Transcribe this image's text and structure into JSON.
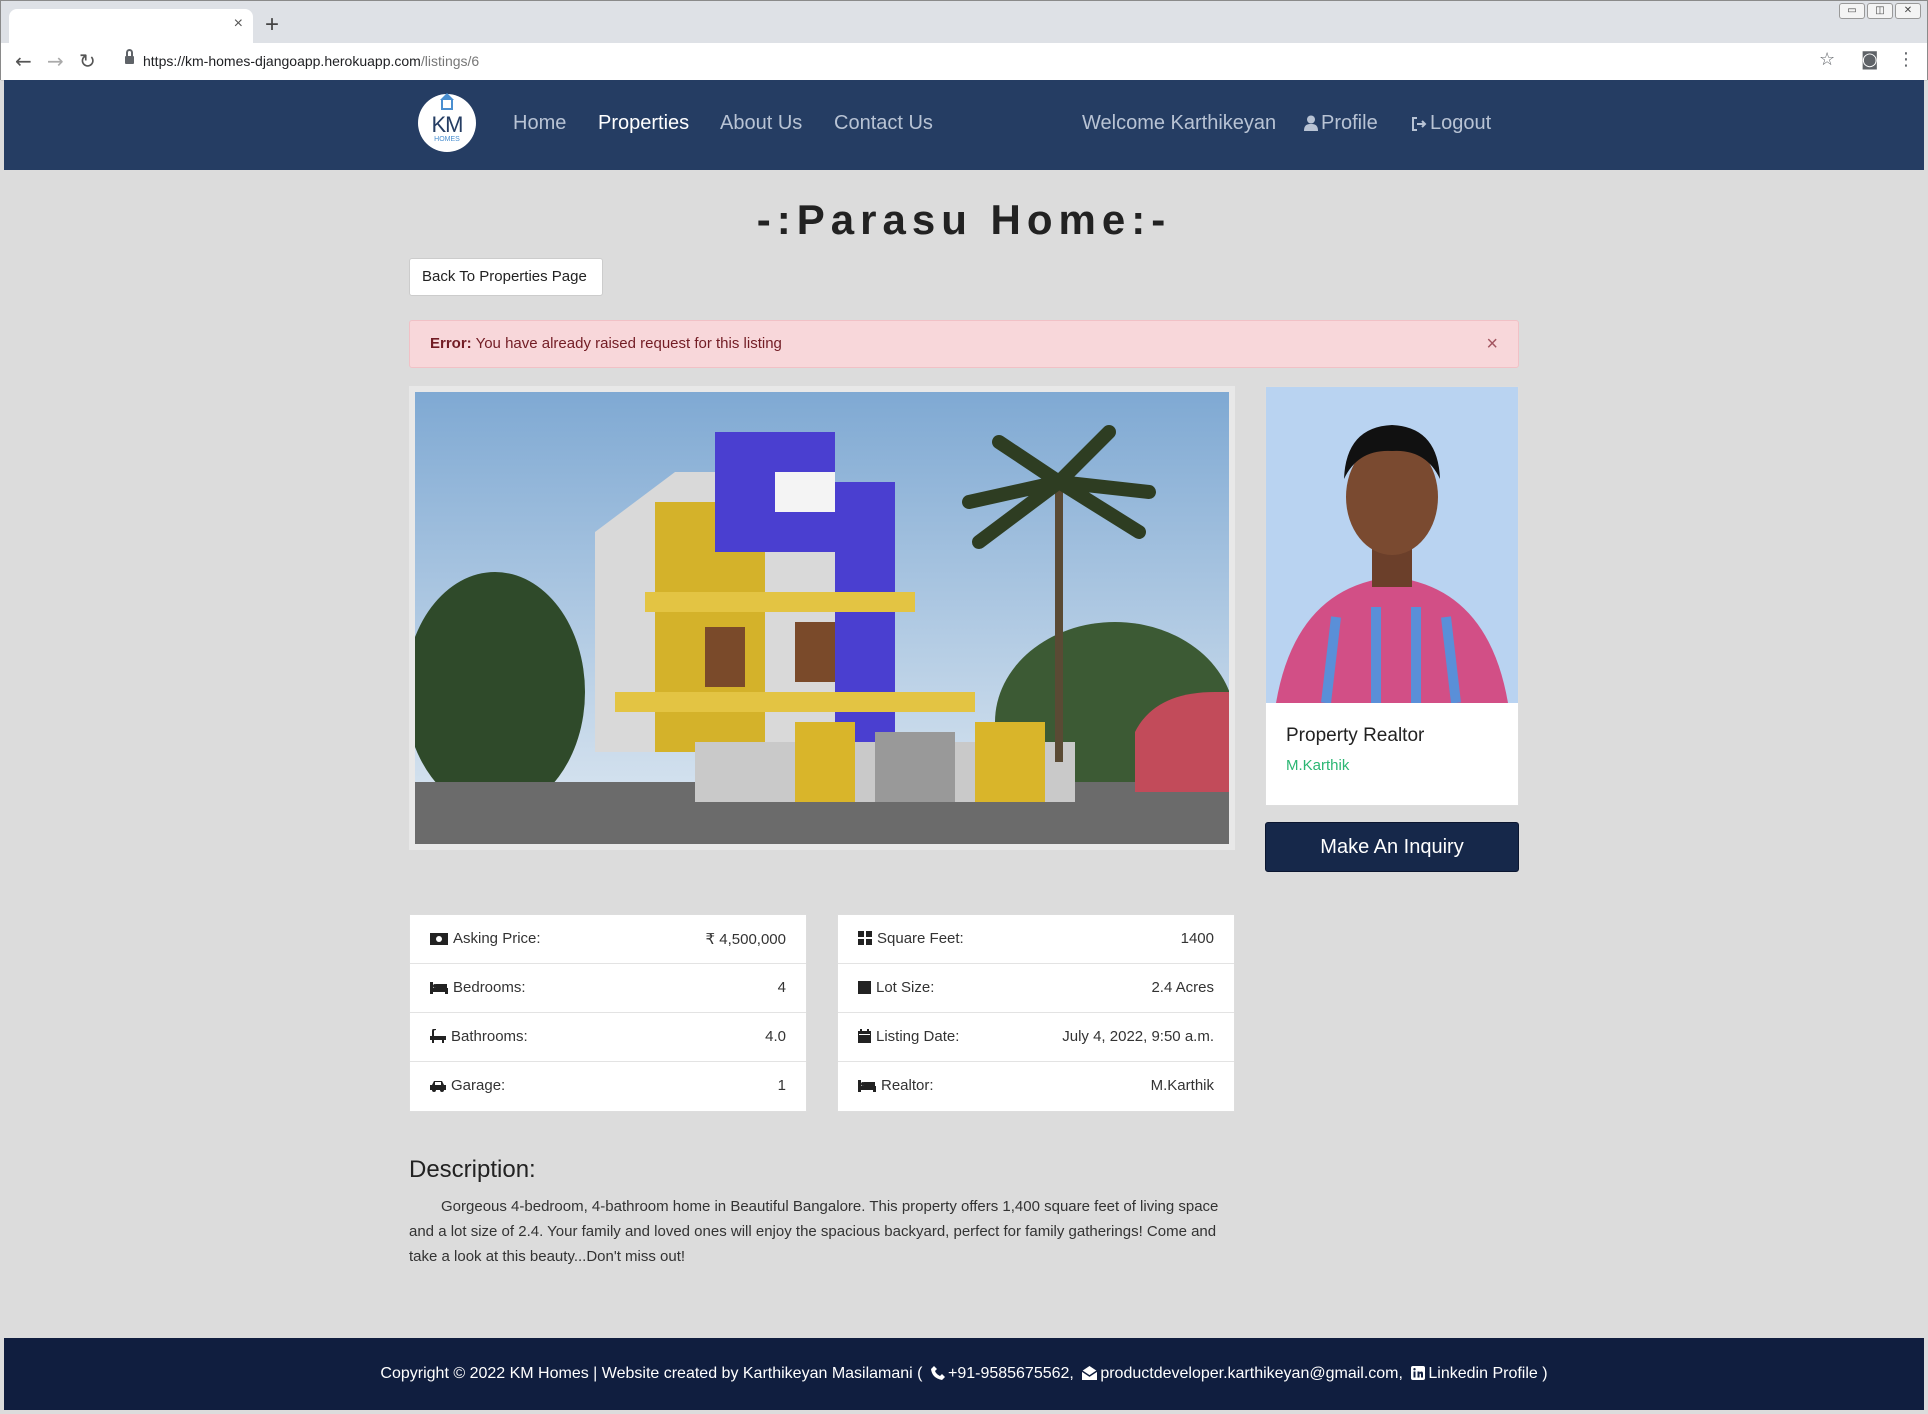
{
  "browser": {
    "tab_close": "×",
    "new_tab": "+",
    "url_base": "https://km-homes-djangoapp.herokuapp.com",
    "url_path": "/listings/6",
    "win_buttons": [
      "▭",
      "◫",
      "✕"
    ]
  },
  "navbar": {
    "logo_text": "KM",
    "logo_sub": "HOMES",
    "links": [
      "Home",
      "Properties",
      "About Us",
      "Contact Us"
    ],
    "welcome": "Welcome Karthikeyan",
    "profile": "Profile",
    "logout": "Logout"
  },
  "listing": {
    "title": "-:Parasu Home:-",
    "back_button": "Back To Properties Page",
    "alert_label": "Error:",
    "alert_message": " You have already raised request for this listing",
    "alert_close": "×"
  },
  "realtor_card": {
    "heading": "Property Realtor",
    "name": "M.Karthik",
    "inquiry_button": "Make An Inquiry"
  },
  "details_left": [
    {
      "label": "Asking Price:",
      "value": "₹ 4,500,000"
    },
    {
      "label": "Bedrooms:",
      "value": "4"
    },
    {
      "label": "Bathrooms:",
      "value": "4.0"
    },
    {
      "label": "Garage:",
      "value": "1"
    }
  ],
  "details_right": [
    {
      "label": "Square Feet:",
      "value": "1400"
    },
    {
      "label": "Lot Size:",
      "value": "2.4 Acres"
    },
    {
      "label": "Listing Date:",
      "value": "July 4, 2022, 9:50 a.m."
    },
    {
      "label": "Realtor:",
      "value": "M.Karthik"
    }
  ],
  "description": {
    "heading": "Description:",
    "text": "Gorgeous 4-bedroom, 4-bathroom home in Beautiful Bangalore. This property offers 1,400 square feet of living space and a lot size of 2.4. Your family and loved ones will enjoy the spacious backyard, perfect for family gatherings! Come and take a look at this beauty...Don't miss out!"
  },
  "footer": {
    "copyright": "Copyright © 2022 KM Homes  |  Website created by Karthikeyan Masilamani (",
    "phone": "+91-9585675562,",
    "email": "productdeveloper.karthikeyan@gmail.com,",
    "linkedin": "Linkedin Profile )"
  },
  "colors": {
    "navbar": "#253d63",
    "footer": "#101e3f",
    "accent_green": "#2bb673",
    "alert_bg": "#f8d7da"
  }
}
